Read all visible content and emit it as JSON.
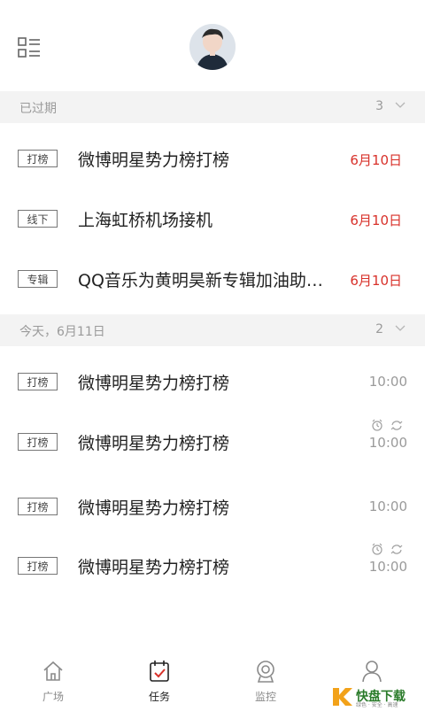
{
  "header": {
    "menu_icon": "list-menu-icon",
    "avatar": "user-avatar"
  },
  "sections": [
    {
      "title": "已过期",
      "count": "3",
      "rows": [
        {
          "tag": "打榜",
          "title": "微博明星势力榜打榜",
          "right": "6月10日"
        },
        {
          "tag": "线下",
          "title": "上海虹桥机场接机",
          "right": "6月10日"
        },
        {
          "tag": "专辑",
          "title": "QQ音乐为黄明昊新专辑加油助…",
          "right": "6月10日"
        }
      ]
    },
    {
      "title": "今天，6月11日",
      "count": "2",
      "rows": [
        {
          "tag": "打榜",
          "title": "微博明星势力榜打榜",
          "right": "10:00"
        },
        {
          "tag": "打榜",
          "title": "微博明星势力榜打榜",
          "right": "10:00",
          "icons": [
            "alarm-icon",
            "repeat-icon"
          ]
        },
        {
          "tag": "打榜",
          "title": "微博明星势力榜打榜",
          "right": "10:00"
        },
        {
          "tag": "打榜",
          "title": "微博明星势力榜打榜",
          "right": "10:00",
          "icons": [
            "alarm-icon",
            "repeat-icon"
          ]
        }
      ]
    }
  ],
  "tabbar": [
    {
      "label": "广场",
      "icon": "home-icon",
      "active": false
    },
    {
      "label": "任务",
      "icon": "calendar-check-icon",
      "active": true
    },
    {
      "label": "监控",
      "icon": "webcam-icon",
      "active": false
    },
    {
      "label": "",
      "icon": "profile-icon",
      "active": false
    }
  ],
  "watermark": {
    "text": "快盘下载",
    "sub": "绿色 · 安全 · 高速"
  },
  "colors": {
    "overdue": "#d8312a",
    "muted": "#9a9a9a",
    "section_bg": "#f3f3f3"
  }
}
